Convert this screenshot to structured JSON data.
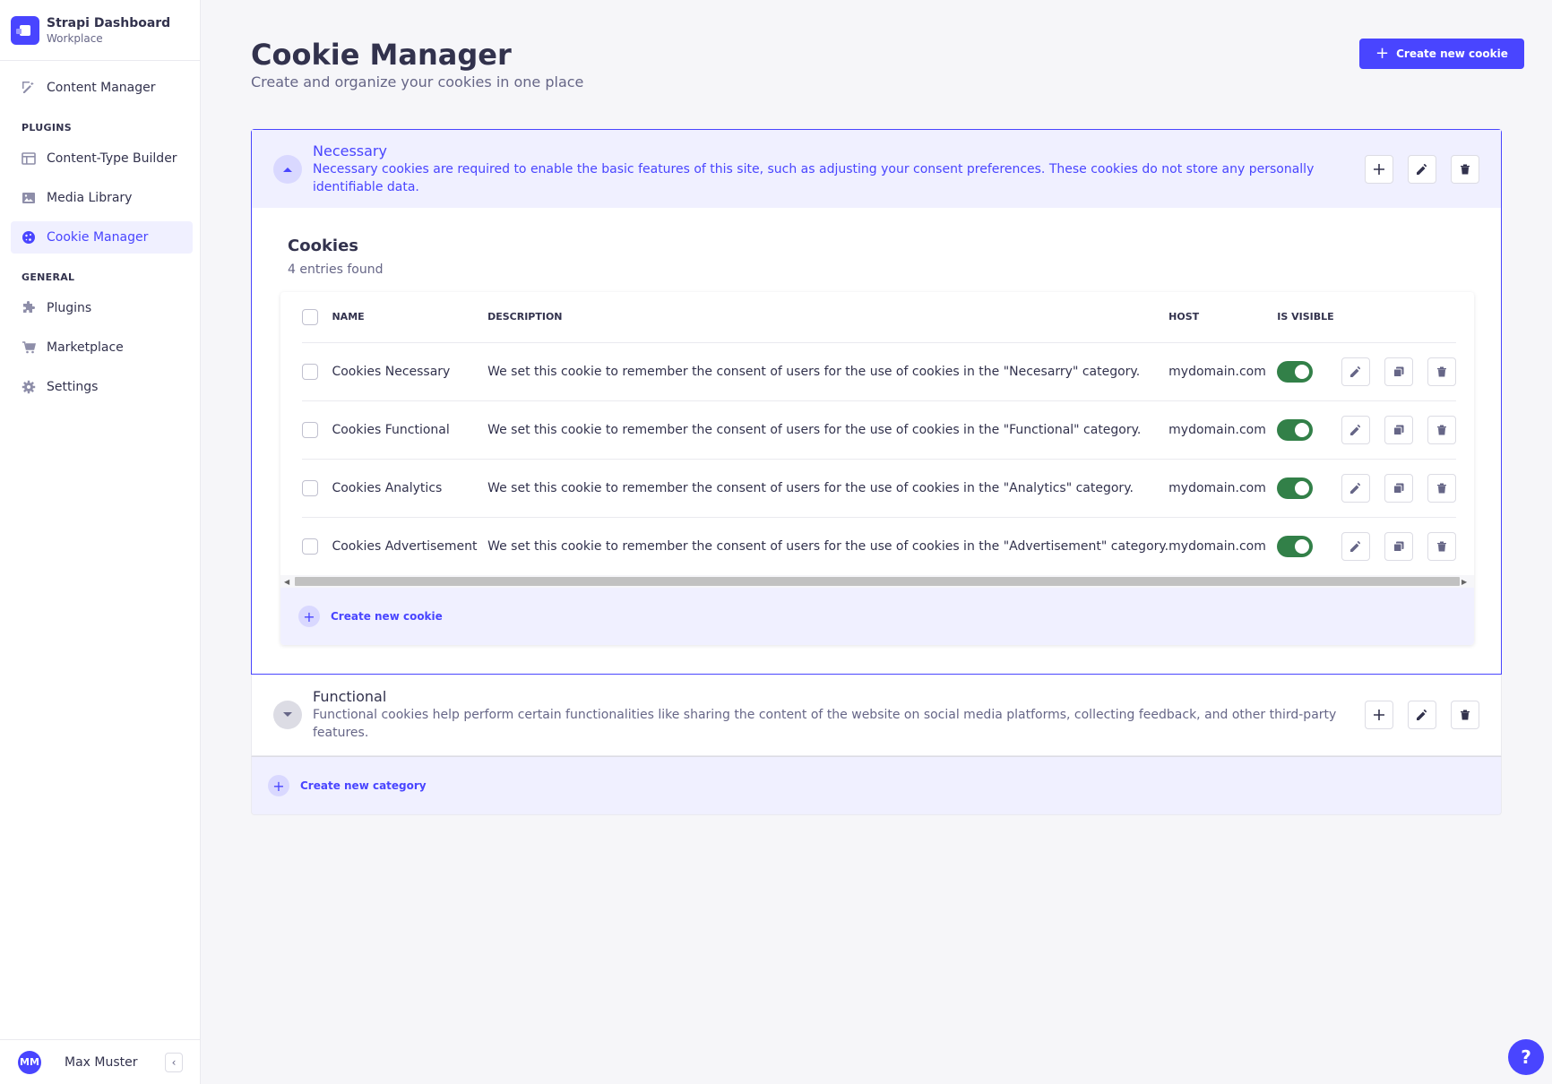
{
  "brand": {
    "title": "Strapi Dashboard",
    "subtitle": "Workplace"
  },
  "sidebar": {
    "top_item": {
      "label": "Content Manager",
      "icon": "pencil-icon"
    },
    "plugins_heading": "PLUGINS",
    "plugins": [
      {
        "label": "Content-Type Builder",
        "icon": "layout-icon"
      },
      {
        "label": "Media Library",
        "icon": "image-icon"
      },
      {
        "label": "Cookie Manager",
        "icon": "cookie-icon",
        "active": true
      }
    ],
    "general_heading": "GENERAL",
    "general": [
      {
        "label": "Plugins",
        "icon": "puzzle-icon"
      },
      {
        "label": "Marketplace",
        "icon": "cart-icon"
      },
      {
        "label": "Settings",
        "icon": "gear-icon"
      }
    ]
  },
  "user": {
    "initials": "MM",
    "name": "Max Muster"
  },
  "header": {
    "title": "Cookie Manager",
    "subtitle": "Create and organize your cookies in one place",
    "create_button": "Create new cookie"
  },
  "categories": [
    {
      "title": "Necessary",
      "description": "Necessary cookies are required to enable the basic features of this site, such as adjusting your consent preferences. These cookies do not store any personally identifiable data.",
      "expanded": true
    },
    {
      "title": "Functional",
      "description": "Functional cookies help perform certain functionalities like sharing the content of the website on social media platforms, collecting feedback, and other third-party features.",
      "expanded": false
    }
  ],
  "cookies_section": {
    "title": "Cookies",
    "count": "4 entries found",
    "columns": {
      "name": "NAME",
      "description": "DESCRIPTION",
      "host": "HOST",
      "visible": "IS VISIBLE"
    },
    "rows": [
      {
        "name": "Cookies Necessary",
        "description": "We set this cookie to remember the consent of users for the use of cookies in the \"Necesarry\" category.",
        "host": "mydomain.com",
        "visible": true
      },
      {
        "name": "Cookies Functional",
        "description": "We set this cookie to remember the consent of users for the use of cookies in the \"Functional\" category.",
        "host": "mydomain.com",
        "visible": true
      },
      {
        "name": "Cookies Analytics",
        "description": "We set this cookie to remember the consent of users for the use of cookies in the \"Analytics\" category.",
        "host": "mydomain.com",
        "visible": true
      },
      {
        "name": "Cookies Advertisement",
        "description": "We set this cookie to remember the consent of users for the use of cookies in the \"Advertisement\" category.",
        "host": "mydomain.com",
        "visible": true
      }
    ],
    "footer_link": "Create new cookie"
  },
  "create_category": "Create new category",
  "help": "?",
  "colors": {
    "primary": "#4945ff",
    "primary_light": "#f0f0ff",
    "success": "#328048",
    "text": "#32324d",
    "muted": "#666687"
  }
}
